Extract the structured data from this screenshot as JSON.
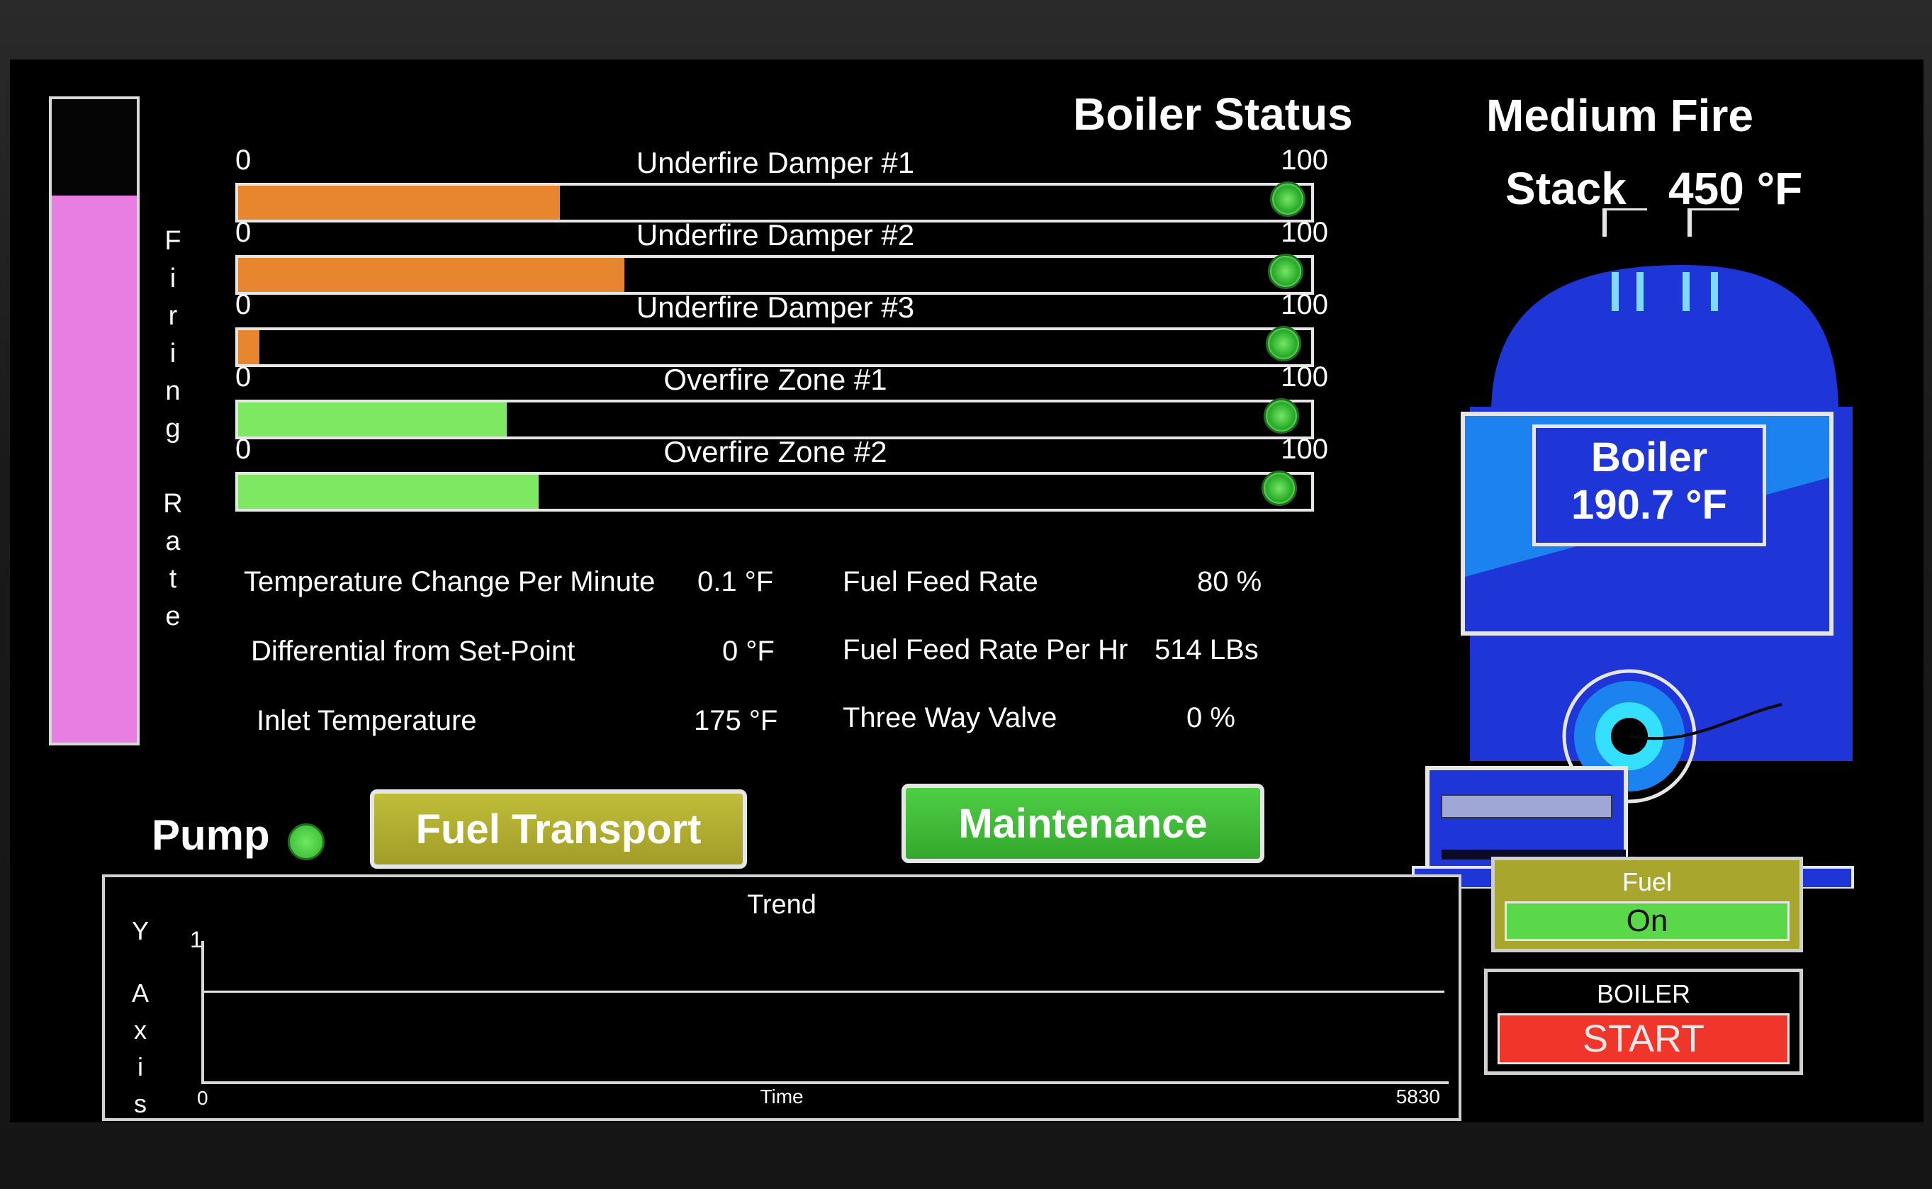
{
  "header": {
    "title": "Boiler Status",
    "fire_mode": "Medium Fire"
  },
  "firing_rate": {
    "label_letters": [
      "F",
      "i",
      "r",
      "i",
      "n",
      "g",
      "R",
      "a",
      "t",
      "e"
    ],
    "level_fraction": 0.85,
    "fill_color": "#e87ee2"
  },
  "dampers": [
    {
      "label": "Underfire Damper #1",
      "min": "0",
      "max": "100",
      "value": 30,
      "color": "#e8862f"
    },
    {
      "label": "Underfire Damper #2",
      "min": "0",
      "max": "100",
      "value": 36,
      "color": "#e8862f"
    },
    {
      "label": "Underfire Damper #3",
      "min": "0",
      "max": "100",
      "value": 2,
      "color": "#e8862f"
    },
    {
      "label": "Overfire Zone #1",
      "min": "0",
      "max": "100",
      "value": 25,
      "color": "#7ee862"
    },
    {
      "label": "Overfire Zone #2",
      "min": "0",
      "max": "100",
      "value": 28,
      "color": "#7ee862"
    }
  ],
  "stats_left": [
    {
      "label": "Temperature Change Per Minute",
      "value": "0.1 °F"
    },
    {
      "label": "Differential from Set-Point",
      "value": "0 °F"
    },
    {
      "label": "Inlet Temperature",
      "value": "175 °F"
    }
  ],
  "stats_right": [
    {
      "label": "Fuel Feed Rate",
      "value": "80 %"
    },
    {
      "label": "Fuel Feed Rate Per Hr",
      "value": "514 LBs"
    },
    {
      "label": "Three Way Valve",
      "value": "0 %"
    }
  ],
  "pump": {
    "label": "Pump"
  },
  "buttons": {
    "fuel_transport": "Fuel Transport",
    "maintenance": "Maintenance"
  },
  "stack": {
    "label": "Stack",
    "temp": "450 °F"
  },
  "boiler": {
    "label": "Boiler",
    "temp": "190.7 °F"
  },
  "trend": {
    "title": "Trend",
    "y_letters": [
      "Y",
      "A",
      "x",
      "i",
      "s"
    ],
    "y_tick": "1",
    "x_label": "Time",
    "x_start": "0",
    "x_end": "5830",
    "y_ratio": 0.5
  },
  "fuel_control": {
    "label": "Fuel",
    "state": "On"
  },
  "boiler_control": {
    "label": "BOILER",
    "action": "START"
  },
  "colors": {
    "boiler_blue": "#1e33d6",
    "boiler_light": "#1a7ff0",
    "led_green": "#3cbf3a",
    "start_red": "#f0362a",
    "olive": "#a9a62e",
    "button_green": "#3fb934"
  }
}
